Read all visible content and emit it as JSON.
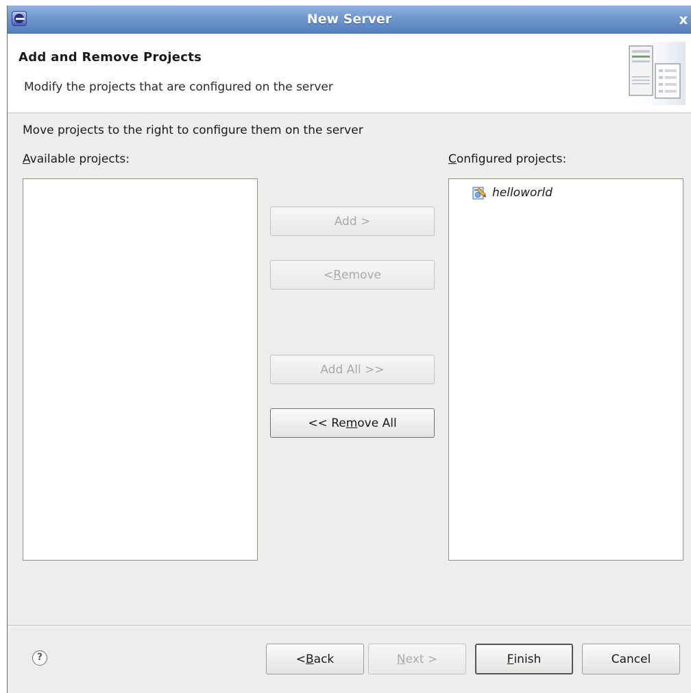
{
  "window": {
    "title": "New Server",
    "close_glyph": "x",
    "icon": "eclipse-icon"
  },
  "banner": {
    "title": "Add and Remove Projects",
    "description": "Modify the projects that are configured on the server",
    "graphic": "server-wizard-icon"
  },
  "instruction": "Move projects to the right to configure them on the server",
  "available": {
    "label_mnemonic": "A",
    "label_rest": "vailable projects:",
    "items": []
  },
  "configured": {
    "label_mnemonic": "C",
    "label_rest": "onfigured projects:",
    "items": [
      {
        "label": "helloworld",
        "icon": "web-project-icon"
      }
    ]
  },
  "transfer_buttons": {
    "add": {
      "label": "Add >",
      "enabled": false
    },
    "remove": {
      "before": "< ",
      "mnemonic": "R",
      "after": "emove",
      "enabled": false
    },
    "add_all": {
      "label": "Add All >>",
      "enabled": false
    },
    "remove_all": {
      "before": "<< Re",
      "mnemonic": "m",
      "after": "ove All",
      "enabled": true
    }
  },
  "footer": {
    "help_glyph": "?",
    "back": {
      "before": "< ",
      "mnemonic": "B",
      "after": "ack",
      "enabled": true
    },
    "next": {
      "before": "",
      "mnemonic": "N",
      "after": "ext >",
      "enabled": false
    },
    "finish": {
      "before": "",
      "mnemonic": "F",
      "after": "inish",
      "enabled": true,
      "default": true
    },
    "cancel": {
      "label": "Cancel",
      "enabled": true
    }
  },
  "colors": {
    "titlebar": "#6f98cf",
    "dialog_bg": "#ededeb",
    "disabled_text": "#a9a9a6"
  }
}
